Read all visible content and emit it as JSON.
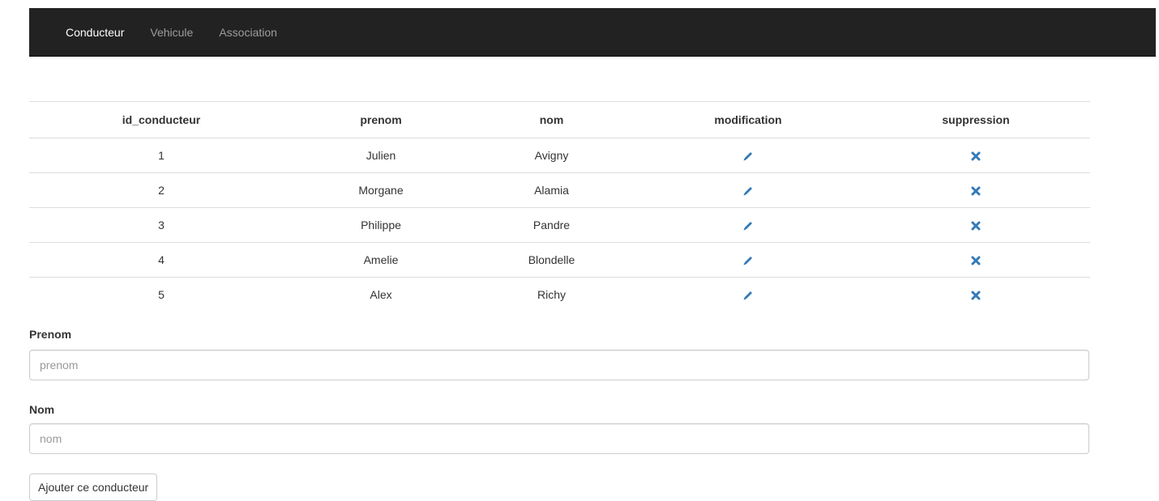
{
  "nav": {
    "items": [
      {
        "label": "Conducteur",
        "active": true
      },
      {
        "label": "Vehicule",
        "active": false
      },
      {
        "label": "Association",
        "active": false
      }
    ]
  },
  "table": {
    "headers": [
      "id_conducteur",
      "prenom",
      "nom",
      "modification",
      "suppression"
    ],
    "rows": [
      {
        "id": "1",
        "prenom": "Julien",
        "nom": "Avigny"
      },
      {
        "id": "2",
        "prenom": "Morgane",
        "nom": "Alamia"
      },
      {
        "id": "3",
        "prenom": "Philippe",
        "nom": "Pandre"
      },
      {
        "id": "4",
        "prenom": "Amelie",
        "nom": "Blondelle"
      },
      {
        "id": "5",
        "prenom": "Alex",
        "nom": "Richy"
      }
    ],
    "edit_icon": "pencil-icon",
    "delete_icon": "remove-icon"
  },
  "form": {
    "prenom_label": "Prenom",
    "prenom_placeholder": "prenom",
    "prenom_value": "",
    "nom_label": "Nom",
    "nom_placeholder": "nom",
    "nom_value": "",
    "submit_label": "Ajouter ce conducteur"
  },
  "colors": {
    "navbar_bg": "#222222",
    "nav_active": "#ffffff",
    "nav_inactive": "#9d9d9d",
    "icon_blue": "#337ab7"
  }
}
